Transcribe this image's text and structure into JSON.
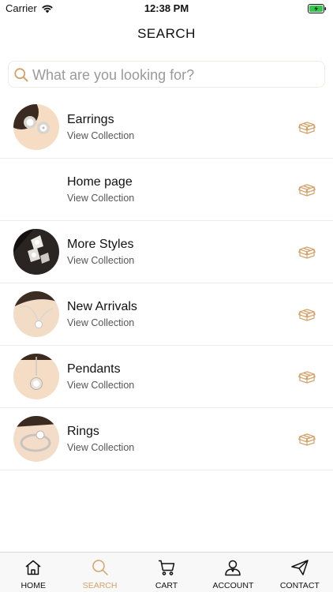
{
  "status": {
    "carrier": "Carrier",
    "time": "12:38 PM"
  },
  "nav": {
    "title": "SEARCH"
  },
  "search": {
    "placeholder": "What are you looking for?",
    "value": ""
  },
  "accent": "#d4a26a",
  "collections": [
    {
      "title": "Earrings",
      "subtitle": "View Collection",
      "thumb": "earrings"
    },
    {
      "title": "Home page",
      "subtitle": "View Collection",
      "thumb": "none"
    },
    {
      "title": "More Styles",
      "subtitle": "View Collection",
      "thumb": "more-styles"
    },
    {
      "title": "New Arrivals",
      "subtitle": "View Collection",
      "thumb": "necklace"
    },
    {
      "title": "Pendants",
      "subtitle": "View Collection",
      "thumb": "pendant"
    },
    {
      "title": "Rings",
      "subtitle": "View Collection",
      "thumb": "ring"
    }
  ],
  "tabs": [
    {
      "label": "HOME",
      "icon": "home-icon",
      "active": false
    },
    {
      "label": "SEARCH",
      "icon": "search-icon",
      "active": true
    },
    {
      "label": "CART",
      "icon": "cart-icon",
      "active": false
    },
    {
      "label": "ACCOUNT",
      "icon": "account-icon",
      "active": false
    },
    {
      "label": "CONTACT",
      "icon": "send-icon",
      "active": false
    }
  ]
}
